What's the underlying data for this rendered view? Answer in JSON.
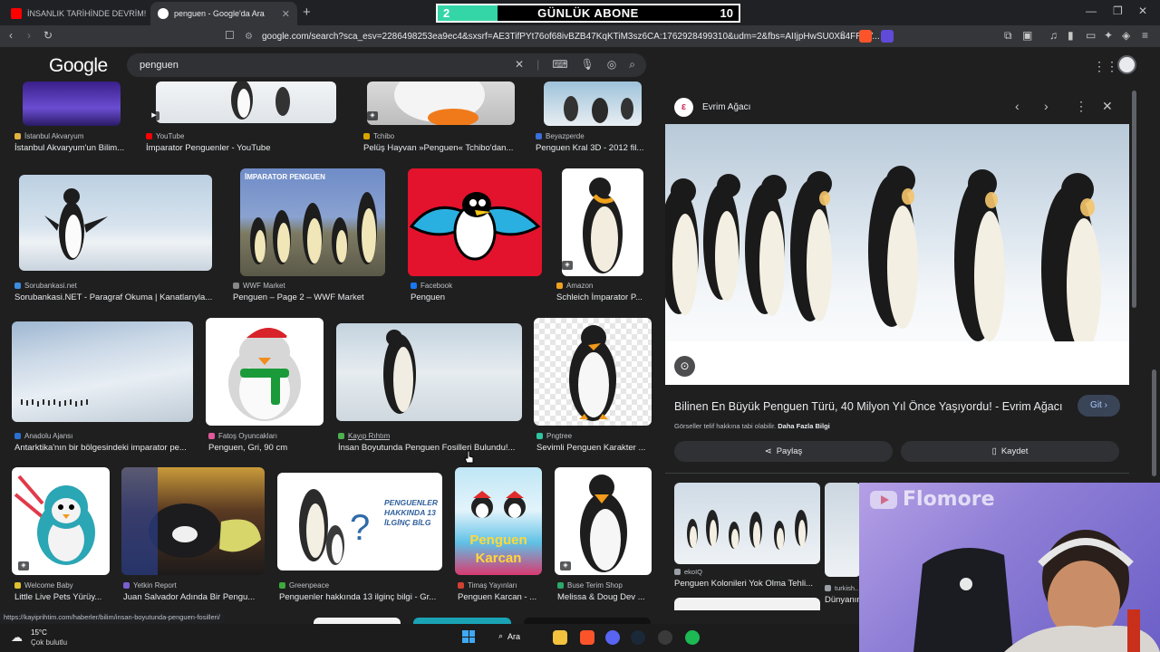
{
  "tabs": [
    {
      "label": "İNSANLIK TARİHİNDE DEVRİM! 🥚 -",
      "fav_color": "#ff0000"
    },
    {
      "label": "penguen - Google'da Ara",
      "fav_color": "#ffffff"
    }
  ],
  "overlay": {
    "level": "2",
    "title": "GÜNLÜK ABONE",
    "goal": "10",
    "progress": 0.2
  },
  "toolbar": {
    "url": "google.com/search?sca_esv=2286498253ea9ec4&sxsrf=AE3TifPYt76of68ivBZB47KqKTiM3sz6CA:1762928499310&udm=2&fbs=AIIjpHwSU0Xn4FRaY..."
  },
  "google": {
    "logo": "Google",
    "query": "penguen"
  },
  "results": [
    {
      "source": "İstanbul Akvaryum",
      "title": "İstanbul Akvaryum'un Bilim...",
      "fav": "#e1b340"
    },
    {
      "source": "YouTube",
      "title": "İmparator Penguenler - YouTube",
      "fav": "#ff0000"
    },
    {
      "source": "Tchibo",
      "title": "Pelüş Hayvan »Penguen« Tchibo'dan...",
      "fav": "#d9a400"
    },
    {
      "source": "Beyazperde",
      "title": "Penguen Kral 3D - 2012 fil...",
      "fav": "#3b6fd9"
    },
    {
      "source": "Sorubankasi.net",
      "title": "Sorubankasi.NET - Paragraf Okuma | Kanatlarıyla...",
      "fav": "#3a8de0"
    },
    {
      "source": "WWF Market",
      "title": "Penguen – Page 2 – WWF Market",
      "fav": "#888888"
    },
    {
      "source": "Facebook",
      "title": "Penguen",
      "fav": "#1877f2"
    },
    {
      "source": "Amazon",
      "title": "Schleich İmparator P...",
      "fav": "#f0a020"
    },
    {
      "source": "Anadolu Ajansı",
      "title": "Antarktika'nın bir bölgesindeki imparator pe...",
      "fav": "#2b6fd0"
    },
    {
      "source": "Fatoş Oyuncakları",
      "title": "Penguen, Gri, 90 cm",
      "fav": "#e05a9a"
    },
    {
      "source": "Kayıp Rıhtım",
      "title": "İnsan Boyutunda Penguen Fosilleri Bulundu!...",
      "fav": "#4caf50"
    },
    {
      "source": "Pngtree",
      "title": "Sevimli Penguen Karakter ...",
      "fav": "#2ec4a0"
    },
    {
      "source": "Welcome Baby",
      "title": "Little Live Pets Yürüy...",
      "fav": "#e0c030"
    },
    {
      "source": "Yetkin Report",
      "title": "Juan Salvador Adında Bir Pengu...",
      "fav": "#7a5fd0"
    },
    {
      "source": "Greenpeace",
      "title": "Penguenler hakkında 13 ilginç bilgi - Gr...",
      "fav": "#3caa3c"
    },
    {
      "source": "Timaş Yayınları",
      "title": "Penguen Karcan - ...",
      "fav": "#d04030"
    },
    {
      "source": "Buse Terim Shop",
      "title": "Melissa & Doug Dev ...",
      "fav": "#2aa86a"
    }
  ],
  "thumb_texts": {
    "wwf": "İMPARATOR PENGUEN",
    "greenpeace": "PENGUENLER HAKKINDA 13 İLGİNÇ BİLG",
    "karcan_1": "Penguen",
    "karcan_2": "Karcan"
  },
  "panel": {
    "source": "Evrim Ağacı",
    "title": "Bilinen En Büyük Penguen Türü, 40 Milyon Yıl Önce Yaşıyordu! - Evrim Ağacı",
    "visit": "Git",
    "copyright": "Görseller telif hakkına tabi olabilir.",
    "more_info": "Daha Fazla Bilgi",
    "share": "Paylaş",
    "save": "Kaydet",
    "related": [
      {
        "source": "ekoIQ",
        "title": "Penguen Kolonileri Yok Olma Tehli..."
      },
      {
        "source": "turkish...",
        "title": "Dünyanın..."
      }
    ]
  },
  "webcam": {
    "brand": "Flomore"
  },
  "status_url": "https://kayiprihtim.com/haberler/bilim/insan-boyutunda-penguen-fosilleri/",
  "taskbar": {
    "temp": "15°C",
    "weather": "Çok bulutlu",
    "search": "Ara"
  }
}
